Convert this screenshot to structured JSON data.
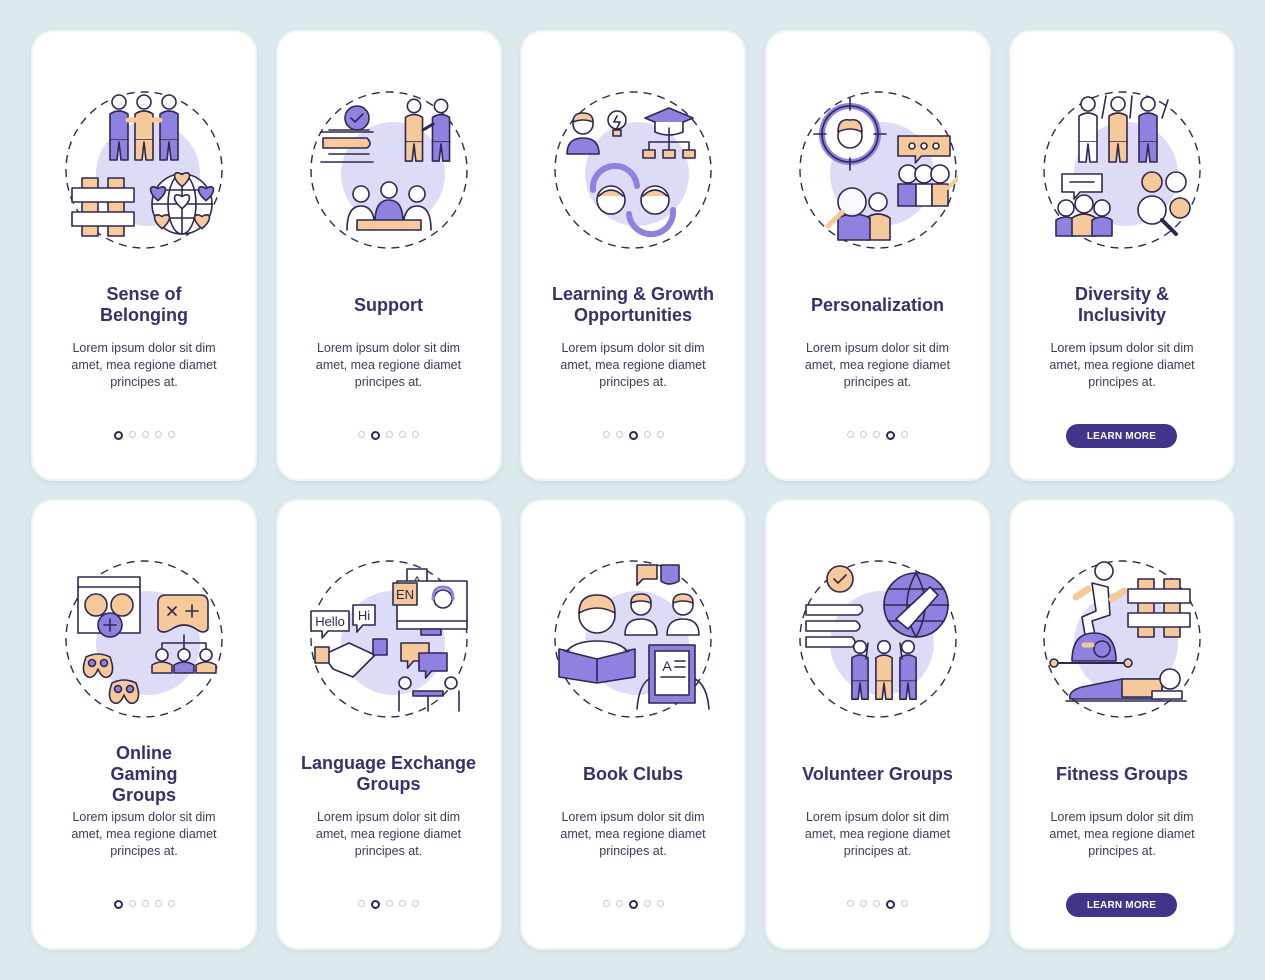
{
  "colors": {
    "background": "#dce9ed",
    "card": "#ffffff",
    "title": "#3a2f6b",
    "accent_purple": "#8f81e0",
    "accent_peach": "#f6c99a",
    "circle_fill": "#dcdcf7",
    "button": "#42348a"
  },
  "screens": [
    {
      "title": "Sense of Belonging",
      "title_lines": [
        "Sense of",
        "Belonging"
      ],
      "description": "Lorem ipsum dolor sit dim amet, mea regione diamet principes at.",
      "illustration": "belonging-icon",
      "active_page": 1,
      "total_pages": 5,
      "show_button": false
    },
    {
      "title": "Support",
      "description": "Lorem ipsum dolor sit dim amet, mea regione diamet principes at.",
      "illustration": "support-icon",
      "active_page": 2,
      "total_pages": 5,
      "show_button": false
    },
    {
      "title": "Learning & Growth Opportunities",
      "description": "Lorem ipsum dolor sit dim amet, mea regione diamet principes at.",
      "illustration": "learning-growth-icon",
      "active_page": 3,
      "total_pages": 5,
      "show_button": false
    },
    {
      "title": "Personalization",
      "description": "Lorem ipsum dolor sit dim amet, mea regione diamet principes at.",
      "illustration": "personalization-icon",
      "active_page": 4,
      "total_pages": 5,
      "show_button": false
    },
    {
      "title": "Diversity & Inclusivity",
      "description": "Lorem ipsum dolor sit dim amet, mea regione diamet principes at.",
      "illustration": "diversity-inclusivity-icon",
      "active_page": 5,
      "total_pages": 5,
      "show_button": true,
      "button_label": "LEARN MORE"
    },
    {
      "title": "Online Gaming Groups",
      "description": "Lorem ipsum dolor sit dim amet, mea regione diamet principes at.",
      "illustration": "gaming-groups-icon",
      "active_page": 1,
      "total_pages": 5,
      "show_button": false
    },
    {
      "title": "Language Exchange Groups",
      "description": "Lorem ipsum dolor sit dim amet, mea regione diamet principes at.",
      "illustration": "language-exchange-icon",
      "active_page": 2,
      "total_pages": 5,
      "show_button": false
    },
    {
      "title": "Book Clubs",
      "description": "Lorem ipsum dolor sit dim amet, mea regione diamet principes at.",
      "illustration": "book-clubs-icon",
      "active_page": 3,
      "total_pages": 5,
      "show_button": false
    },
    {
      "title": "Volunteer Groups",
      "description": "Lorem ipsum dolor sit dim amet, mea regione diamet principes at.",
      "illustration": "volunteer-groups-icon",
      "active_page": 4,
      "total_pages": 5,
      "show_button": false
    },
    {
      "title": "Fitness Groups",
      "description": "Lorem ipsum dolor sit dim amet, mea regione diamet principes at.",
      "illustration": "fitness-groups-icon",
      "active_page": 5,
      "total_pages": 5,
      "show_button": true,
      "button_label": "LEARN MORE"
    }
  ],
  "illustration_labels": {
    "hello": "Hello",
    "hi": "Hi",
    "en": "EN",
    "a": "A"
  }
}
